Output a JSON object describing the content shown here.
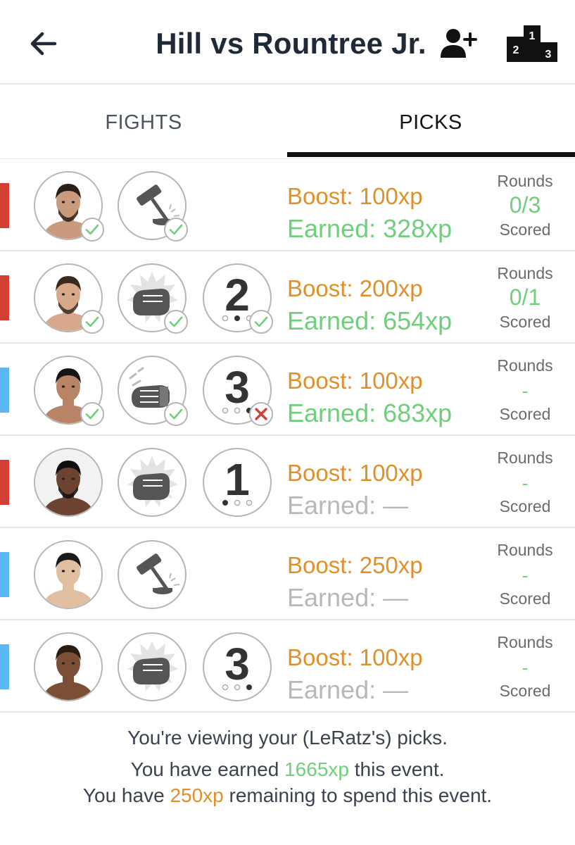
{
  "header": {
    "title": "Hill vs Rountree Jr.",
    "back_icon": "arrow-left-icon",
    "add_user_icon": "user-plus-icon",
    "leaderboard_icon": "podium-icon",
    "podium": {
      "first": "1",
      "second": "2",
      "third": "3"
    }
  },
  "tabs": [
    {
      "label": "FIGHTS",
      "active": false
    },
    {
      "label": "PICKS",
      "active": true
    }
  ],
  "colors": {
    "red_corner": "#d23f35",
    "blue_corner": "#5bb8f5",
    "boost": "#e0902a",
    "earned": "#6fcf7b",
    "pending": "#b8b8b8"
  },
  "picks": [
    {
      "corner": "red",
      "method_icon": "gavel-icon",
      "fighter_correct": true,
      "method_correct": true,
      "round": null,
      "boost": "Boost: 100xp",
      "earned": "Earned: 328xp",
      "earned_pending": false,
      "rounds_label": "Rounds",
      "rounds_value": "0/3",
      "scored_label": "Scored"
    },
    {
      "corner": "red",
      "method_icon": "punch-ko-icon",
      "fighter_correct": true,
      "method_correct": true,
      "round": {
        "number": "2",
        "dot_index": 1,
        "correct": true
      },
      "boost": "Boost: 200xp",
      "earned": "Earned: 654xp",
      "earned_pending": false,
      "rounds_label": "Rounds",
      "rounds_value": "0/1",
      "scored_label": "Scored"
    },
    {
      "corner": "blue",
      "method_icon": "submission-icon",
      "fighter_correct": true,
      "method_correct": true,
      "round": {
        "number": "3",
        "dot_index": 2,
        "correct": false
      },
      "boost": "Boost: 100xp",
      "earned": "Earned: 683xp",
      "earned_pending": false,
      "rounds_label": "Rounds",
      "rounds_value": "-",
      "scored_label": "Scored"
    },
    {
      "corner": "red",
      "method_icon": "punch-ko-icon",
      "fighter_correct": null,
      "method_correct": null,
      "round": {
        "number": "1",
        "dot_index": 0,
        "correct": null
      },
      "boost": "Boost: 100xp",
      "earned": "Earned: —",
      "earned_pending": true,
      "rounds_label": "Rounds",
      "rounds_value": "-",
      "scored_label": "Scored"
    },
    {
      "corner": "blue",
      "method_icon": "gavel-icon",
      "fighter_correct": null,
      "method_correct": null,
      "round": null,
      "boost": "Boost: 250xp",
      "earned": "Earned: —",
      "earned_pending": true,
      "rounds_label": "Rounds",
      "rounds_value": "-",
      "scored_label": "Scored"
    },
    {
      "corner": "blue",
      "method_icon": "punch-ko-icon",
      "fighter_correct": null,
      "method_correct": null,
      "round": {
        "number": "3",
        "dot_index": 2,
        "correct": null
      },
      "boost": "Boost: 100xp",
      "earned": "Earned: —",
      "earned_pending": true,
      "rounds_label": "Rounds",
      "rounds_value": "-",
      "scored_label": "Scored"
    }
  ],
  "footer": {
    "line1": "You're viewing your (LeRatz's) picks.",
    "line2_prefix": "You have earned ",
    "line2_value": "1665xp",
    "line2_suffix": " this event.",
    "line3_prefix": "You have ",
    "line3_value": "250xp",
    "line3_suffix": " remaining to spend this event."
  }
}
